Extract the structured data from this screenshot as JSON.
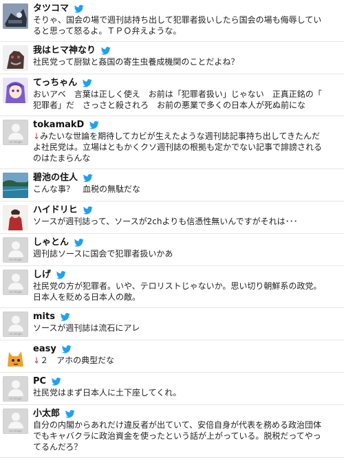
{
  "brand_color": "#1da1f2",
  "placeholder_label": "no image",
  "tweets": [
    {
      "name": "タツコマ",
      "avatar": "robot",
      "lines": [
        "そりゃ、国会の場で週刊誌持ち出して犯罪者扱いしたら国会の場も侮辱してい",
        "ると思って怒るよ。ＴＰＯ弁えような。"
      ]
    },
    {
      "name": "我はヒマ神なり",
      "avatar": "creature",
      "lines": [
        "社民党って厨獄と姦国の寄生虫養成機関のことだよね？"
      ]
    },
    {
      "name": "てっちゃん",
      "avatar": "anime",
      "lines": [
        "おいアベ　言葉は正しく使え　お前は「犯罪者扱い」じゃない　正真正銘の「",
        "犯罪者」だ　さっさと殺されろ　お前の悪業で多くの日本人が死ぬ前にな"
      ]
    },
    {
      "name": "tokamakD",
      "avatar": "none",
      "arrow": "↓",
      "lines": [
        "みたいな世論を期待してカビが生えたような週刊誌記事持ち出してきたんだ",
        "よ社民党は。立場はともかくクソ週刊誌の根拠も定かでない記事で誹謗される",
        "のはたまらんな"
      ]
    },
    {
      "name": "碧池の住人",
      "avatar": "landscape",
      "lines": [
        "こんな事？　血税の無駄だな"
      ]
    },
    {
      "name": "ハイドリヒ",
      "avatar": "figure",
      "lines": [
        "ソースが週刊誌って、ソースが2chよりも信憑性無いんですがそれは･･･"
      ]
    },
    {
      "name": "しゃとん",
      "avatar": "none",
      "lines": [
        "週刊誌ソースに国会で犯罪者扱いかあ"
      ]
    },
    {
      "name": "しげ",
      "avatar": "none",
      "lines": [
        "社民党の方が犯罪者。いや、テロリストじゃないか。思い切り朝鮮系の政党。",
        "日本人を貶める日本人の敵。"
      ]
    },
    {
      "name": "mits",
      "avatar": "none",
      "lines": [
        "ソースが週刊誌は流石にアレ"
      ]
    },
    {
      "name": "easy",
      "avatar": "cat",
      "arrow": "↓",
      "lines": [
        "２　アホの典型だな"
      ]
    },
    {
      "name": "PC",
      "avatar": "none",
      "lines": [
        "社民党はまず日本人に土下座してくれ。"
      ]
    },
    {
      "name": "小太郎",
      "avatar": "none",
      "lines": [
        "自分の内閣からあれだけ違反者が出ていて、安倍自身が代表を務める政治団体",
        "でもキャバクラに政治資金を使ったという話が上がっている。脱税だってやっ",
        "てるんだろ？"
      ]
    }
  ]
}
